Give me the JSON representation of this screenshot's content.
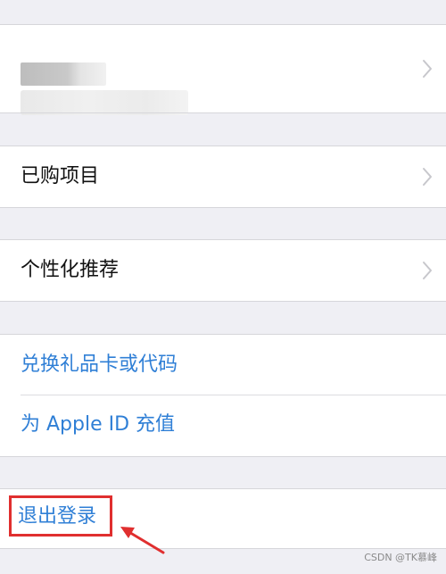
{
  "account": {
    "chevron_icon": "chevron-right-icon"
  },
  "purchased": {
    "label": "已购项目"
  },
  "personalized": {
    "label": "个性化推荐"
  },
  "gift": {
    "redeem_label": "兑换礼品卡或代码",
    "topup_label": "为 Apple ID 充值"
  },
  "signout": {
    "label": "退出登录"
  },
  "colors": {
    "background": "#efeff4",
    "cell": "#ffffff",
    "link_blue": "#2f7fd6",
    "highlight_red": "#e02f2f",
    "separator": "#d6d6da"
  },
  "watermark": {
    "text": "CSDN @TK慕峰"
  }
}
